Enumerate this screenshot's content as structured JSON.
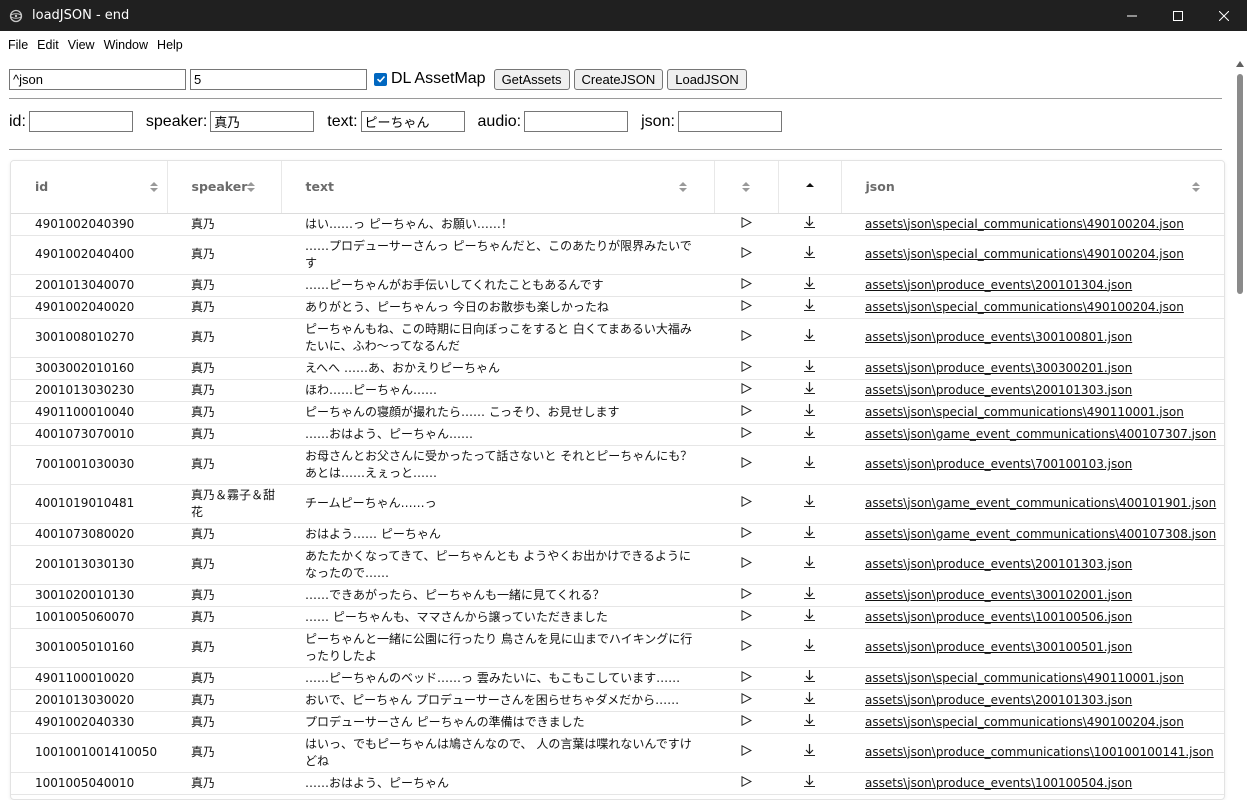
{
  "window": {
    "title": "loadJSON - end"
  },
  "menu": [
    "File",
    "Edit",
    "View",
    "Window",
    "Help"
  ],
  "toolbar": {
    "query_value": "^json",
    "limit_value": "5",
    "dl_assetmap_label": "DL AssetMap",
    "dl_assetmap_checked": true,
    "get_assets_label": "GetAssets",
    "create_json_label": "CreateJSON",
    "load_json_label": "LoadJSON"
  },
  "filters": {
    "id_label": "id:",
    "id_value": "",
    "speaker_label": "speaker:",
    "speaker_value": "真乃",
    "text_label": "text:",
    "text_value": "ピーちゃん",
    "audio_label": "audio:",
    "audio_value": "",
    "json_label": "json:",
    "json_value": ""
  },
  "table": {
    "headers": {
      "id": "id",
      "speaker": "speaker",
      "text": "text",
      "json": "json"
    },
    "rows": [
      {
        "id": "4901002040390",
        "speaker": "真乃",
        "text": "はい……っ ピーちゃん、お願い……！",
        "json": "assets\\json\\special_communications\\490100204.json"
      },
      {
        "id": "4901002040400",
        "speaker": "真乃",
        "text": "……プロデューサーさんっ ピーちゃんだと、このあたりが限界みたいです",
        "json": "assets\\json\\special_communications\\490100204.json"
      },
      {
        "id": "2001013040070",
        "speaker": "真乃",
        "text": "……ピーちゃんがお手伝いしてくれたこともあるんです",
        "json": "assets\\json\\produce_events\\200101304.json"
      },
      {
        "id": "4901002040020",
        "speaker": "真乃",
        "text": "ありがとう、ピーちゃんっ 今日のお散歩も楽しかったね",
        "json": "assets\\json\\special_communications\\490100204.json"
      },
      {
        "id": "3001008010270",
        "speaker": "真乃",
        "text": "ピーちゃんもね、この時期に日向ぼっこをすると 白くてまあるい大福みたいに、ふわ～ってなるんだ",
        "json": "assets\\json\\produce_events\\300100801.json"
      },
      {
        "id": "3003002010160",
        "speaker": "真乃",
        "text": "えへへ ……あ、おかえりピーちゃん",
        "json": "assets\\json\\produce_events\\300300201.json"
      },
      {
        "id": "2001013030230",
        "speaker": "真乃",
        "text": "ほわ……ピーちゃん……",
        "json": "assets\\json\\produce_events\\200101303.json"
      },
      {
        "id": "4901100010040",
        "speaker": "真乃",
        "text": "ピーちゃんの寝顔が撮れたら…… こっそり、お見せします",
        "json": "assets\\json\\special_communications\\490110001.json"
      },
      {
        "id": "4001073070010",
        "speaker": "真乃",
        "text": "……おはよう、ピーちゃん……",
        "json": "assets\\json\\game_event_communications\\400107307.json"
      },
      {
        "id": "7001001030030",
        "speaker": "真乃",
        "text": "お母さんとお父さんに受かったって話さないと それとピーちゃんにも？　あとは……えぇっと……",
        "json": "assets\\json\\produce_events\\700100103.json"
      },
      {
        "id": "4001019010481",
        "speaker": "真乃＆霧子＆甜花",
        "text": "チームピーちゃん……っ",
        "json": "assets\\json\\game_event_communications\\400101901.json"
      },
      {
        "id": "4001073080020",
        "speaker": "真乃",
        "text": "おはよう…… ピーちゃん",
        "json": "assets\\json\\game_event_communications\\400107308.json"
      },
      {
        "id": "2001013030130",
        "speaker": "真乃",
        "text": "あたたかくなってきて、ピーちゃんとも ようやくお出かけできるようになったので……",
        "json": "assets\\json\\produce_events\\200101303.json"
      },
      {
        "id": "3001020010130",
        "speaker": "真乃",
        "text": "……できあがったら、ピーちゃんも一緒に見てくれる？",
        "json": "assets\\json\\produce_events\\300102001.json"
      },
      {
        "id": "1001005060070",
        "speaker": "真乃",
        "text": "…… ピーちゃんも、ママさんから譲っていただきました",
        "json": "assets\\json\\produce_events\\100100506.json"
      },
      {
        "id": "3001005010160",
        "speaker": "真乃",
        "text": "ピーちゃんと一緒に公園に行ったり 鳥さんを見に山までハイキングに行ったりしたよ",
        "json": "assets\\json\\produce_events\\300100501.json"
      },
      {
        "id": "4901100010020",
        "speaker": "真乃",
        "text": "……ピーちゃんのベッド……っ 雲みたいに、もこもこしています……",
        "json": "assets\\json\\special_communications\\490110001.json"
      },
      {
        "id": "2001013030020",
        "speaker": "真乃",
        "text": "おいで、ピーちゃん プロデューサーさんを困らせちゃダメだから……",
        "json": "assets\\json\\produce_events\\200101303.json"
      },
      {
        "id": "4901002040330",
        "speaker": "真乃",
        "text": "プロデューサーさん ピーちゃんの準備はできました",
        "json": "assets\\json\\special_communications\\490100204.json"
      },
      {
        "id": "1001001001410050",
        "speaker": "真乃",
        "text": "はいっ、でもピーちゃんは鳩さんなので、 人の言葉は喋れないんですけどね",
        "json": "assets\\json\\produce_communications\\100100100141.json"
      },
      {
        "id": "1001005040010",
        "speaker": "真乃",
        "text": "……おはよう、ピーちゃん",
        "json": "assets\\json\\produce_events\\100100504.json"
      }
    ]
  },
  "colors": {
    "titlebar": "#202020",
    "accent": "#0067c0"
  }
}
